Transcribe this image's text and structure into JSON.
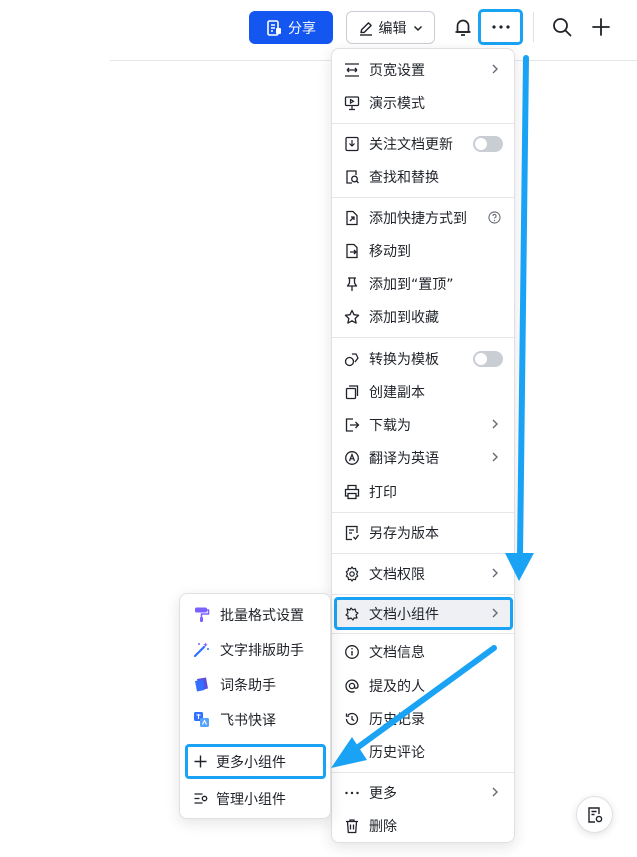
{
  "toolbar": {
    "share_label": "分享",
    "edit_label": "编辑"
  },
  "menu": {
    "items": [
      {
        "label": "页宽设置",
        "icon": "page-width-icon"
      },
      {
        "label": "演示模式",
        "icon": "presentation-icon"
      },
      {
        "label": "关注文档更新",
        "icon": "follow-icon"
      },
      {
        "label": "查找和替换",
        "icon": "find-replace-icon"
      },
      {
        "label": "添加快捷方式到",
        "icon": "shortcut-icon"
      },
      {
        "label": "移动到",
        "icon": "move-icon"
      },
      {
        "label": "添加到“置顶”",
        "icon": "pin-icon"
      },
      {
        "label": "添加到收藏",
        "icon": "star-icon"
      },
      {
        "label": "转换为模板",
        "icon": "template-icon"
      },
      {
        "label": "创建副本",
        "icon": "copy-icon"
      },
      {
        "label": "下载为",
        "icon": "download-icon"
      },
      {
        "label": "翻译为英语",
        "icon": "translate-icon"
      },
      {
        "label": "打印",
        "icon": "print-icon"
      },
      {
        "label": "另存为版本",
        "icon": "version-icon"
      },
      {
        "label": "文档权限",
        "icon": "gear-icon"
      },
      {
        "label": "文档小组件",
        "icon": "widget-icon"
      },
      {
        "label": "文档信息",
        "icon": "info-icon"
      },
      {
        "label": "提及的人",
        "icon": "mention-icon"
      },
      {
        "label": "历史记录",
        "icon": "history-icon"
      },
      {
        "label": "历史评论",
        "icon": "comment-history-icon"
      },
      {
        "label": "更多",
        "icon": "more-icon"
      },
      {
        "label": "删除",
        "icon": "trash-icon"
      }
    ]
  },
  "submenu": {
    "items": [
      {
        "label": "批量格式设置",
        "icon": "format-brush-icon"
      },
      {
        "label": "文字排版助手",
        "icon": "magic-wand-icon"
      },
      {
        "label": "词条助手",
        "icon": "glossary-icon"
      },
      {
        "label": "飞书快译",
        "icon": "quick-translate-icon"
      },
      {
        "label": "更多小组件",
        "icon": "plus-icon"
      },
      {
        "label": "管理小组件",
        "icon": "manage-widgets-icon"
      }
    ]
  },
  "colors": {
    "accent": "#1456f0",
    "highlight_border": "#1aa3f5"
  }
}
